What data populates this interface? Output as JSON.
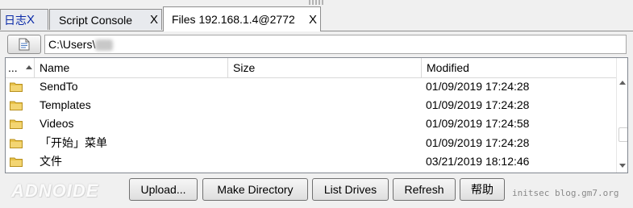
{
  "tabs": [
    {
      "label": "日志",
      "close": "X"
    },
    {
      "label": "Script Console",
      "close": "X"
    },
    {
      "label": "Files 192.168.1.4@2772",
      "close": "X"
    }
  ],
  "path": {
    "value": "C:\\Users\\",
    "button_icon": "document-icon"
  },
  "columns": {
    "dots": "...",
    "name": "Name",
    "size": "Size",
    "modified": "Modified"
  },
  "files": [
    {
      "name": "SendTo",
      "size": "",
      "modified": "01/09/2019 17:24:28",
      "icon": "folder-icon"
    },
    {
      "name": "Templates",
      "size": "",
      "modified": "01/09/2019 17:24:28",
      "icon": "folder-icon"
    },
    {
      "name": "Videos",
      "size": "",
      "modified": "01/09/2019 17:24:58",
      "icon": "folder-icon"
    },
    {
      "name": "「开始」菜单",
      "size": "",
      "modified": "01/09/2019 17:24:28",
      "icon": "folder-icon"
    },
    {
      "name": "文件",
      "size": "",
      "modified": "03/21/2019 18:12:46",
      "icon": "folder-icon"
    }
  ],
  "buttons": {
    "upload": "Upload...",
    "make_directory": "Make Directory",
    "list_drives": "List Drives",
    "refresh": "Refresh",
    "help": "帮助"
  },
  "watermark": {
    "logo": "ADNOIDE",
    "footer": "initsec blog.gm7.org"
  },
  "colors": {
    "folder": "#e8c24a",
    "folder_edge": "#b8901e",
    "tab_cn_text": "#0a2aa8"
  }
}
